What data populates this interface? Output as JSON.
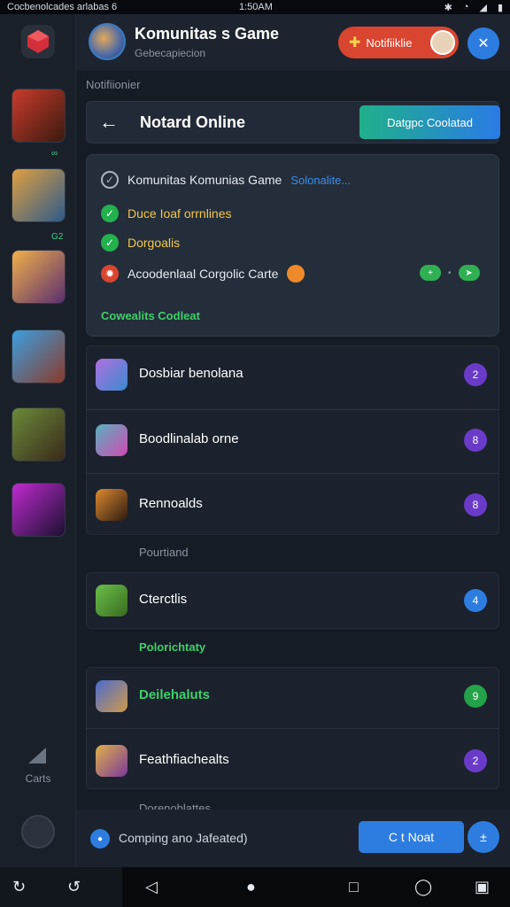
{
  "status_bar": {
    "left": "Cocbenolcades arlabas  6",
    "time": "1:50AM",
    "icons": [
      "bluetooth-icon",
      "wifi-icon",
      "signal-icon",
      "battery-icon"
    ]
  },
  "rail": {
    "tags": [
      "∞",
      "G2"
    ],
    "carts_label": "Carts"
  },
  "header": {
    "title": "Komunitas s Game",
    "subtitle": "Gebecapiecion",
    "notif_label": "Notifiiklie"
  },
  "section_label": "Notifiionier",
  "title_bar": {
    "title": "Notard Online",
    "action": "Datgpc Coolatad"
  },
  "card": {
    "rows": [
      {
        "text": "Komunitas Komunias Game",
        "link": "Solonalite..."
      },
      {
        "text": "Duce Ioaf orrnlines"
      },
      {
        "text": "Dorgoalis"
      },
      {
        "text": "Acoodenlaal Corgolic Carte"
      }
    ],
    "footer": "Cowealits Codleat"
  },
  "list": {
    "items": [
      {
        "label": "Dosbiar benolana",
        "count": "2",
        "color": "#6a3bc9"
      },
      {
        "label": "Boodlinalab orne",
        "count": "8",
        "color": "#6a3bc9"
      },
      {
        "label": "Rennoalds",
        "count": "8",
        "color": "#6a3bc9"
      },
      {
        "label": "Cterctlis",
        "count": "4",
        "color": "#2d7de0"
      },
      {
        "label": "Deilehaluts",
        "count": "9",
        "color": "#23a24a"
      },
      {
        "label": "Feathfiachealts",
        "count": "2",
        "color": "#6a3bc9"
      }
    ],
    "groups": [
      "Pourtiand",
      "Polorichtaty",
      "Dorenoblattes"
    ]
  },
  "footer": {
    "text": "Comping ano Jafeated)",
    "btn1": "C t Noat",
    "btn2": "±"
  },
  "colors": {
    "accent": "#2d7de0",
    "danger": "#d9452f",
    "success": "#23b14d"
  }
}
